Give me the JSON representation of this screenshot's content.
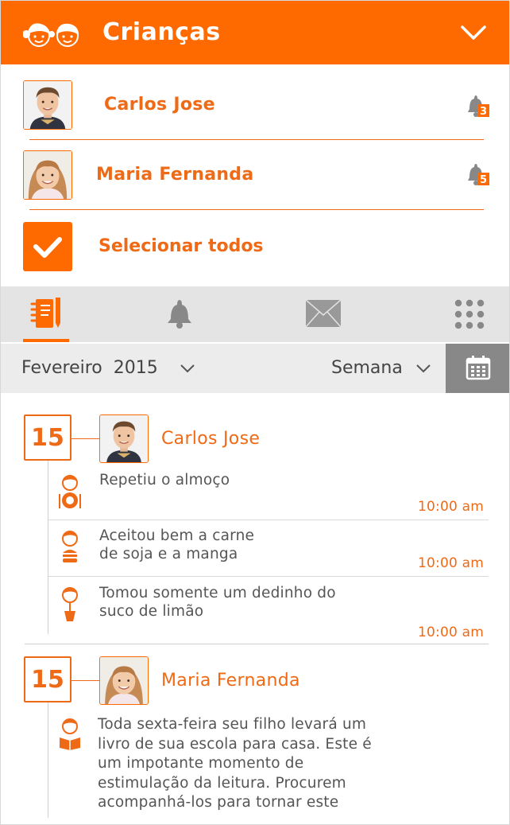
{
  "header": {
    "title": "Crianças",
    "kids_icon": "kids-faces-icon",
    "toggle_icon": "chevron-down-icon",
    "bg_color": "#ff6a00"
  },
  "children": [
    {
      "name": "Carlos Jose",
      "notifications": "3",
      "icon": "bell-icon"
    },
    {
      "name": "Maria Fernanda",
      "notifications": "5",
      "icon": "bell-icon"
    }
  ],
  "select_all": {
    "label": "Selecionar todos",
    "checked": true
  },
  "tabs": [
    {
      "name": "agenda",
      "icon": "notebook-pen-icon",
      "active": true
    },
    {
      "name": "notifications",
      "icon": "bell-icon",
      "active": false
    },
    {
      "name": "messages",
      "icon": "envelope-icon",
      "active": false
    },
    {
      "name": "menu",
      "icon": "grid-dots-icon",
      "active": false
    }
  ],
  "filter": {
    "month": "Fevereiro",
    "year": "2015",
    "period": "Semana",
    "calendar_icon": "calendar-icon"
  },
  "feed": [
    {
      "day": "15",
      "child": "Carlos Jose",
      "items": [
        {
          "icon": "kid-eating-icon",
          "lines": [
            "Repetiu o almoço"
          ],
          "time": "10:00 am"
        },
        {
          "icon": "kid-burger-icon",
          "lines": [
            "Aceitou bem a carne",
            "de soja e a manga"
          ],
          "time": "10:00 am"
        },
        {
          "icon": "kid-drink-icon",
          "lines": [
            "Tomou somente um dedinho do",
            "suco de limão"
          ],
          "time": "10:00 am"
        }
      ]
    },
    {
      "day": "15",
      "child": "Maria Fernanda",
      "items": [
        {
          "icon": "kid-reading-icon",
          "lines": [
            "Toda sexta-feira seu filho levará um",
            "livro de sua escola para casa. Este é",
            "um impotante momento de",
            "estimulação da leitura. Procurem",
            "acompanhá-los para tornar este"
          ]
        }
      ]
    }
  ],
  "colors": {
    "accent": "#ff6a00",
    "text": "#555555",
    "tabbar": "#e4e4e4",
    "filterbar": "#ececec"
  }
}
